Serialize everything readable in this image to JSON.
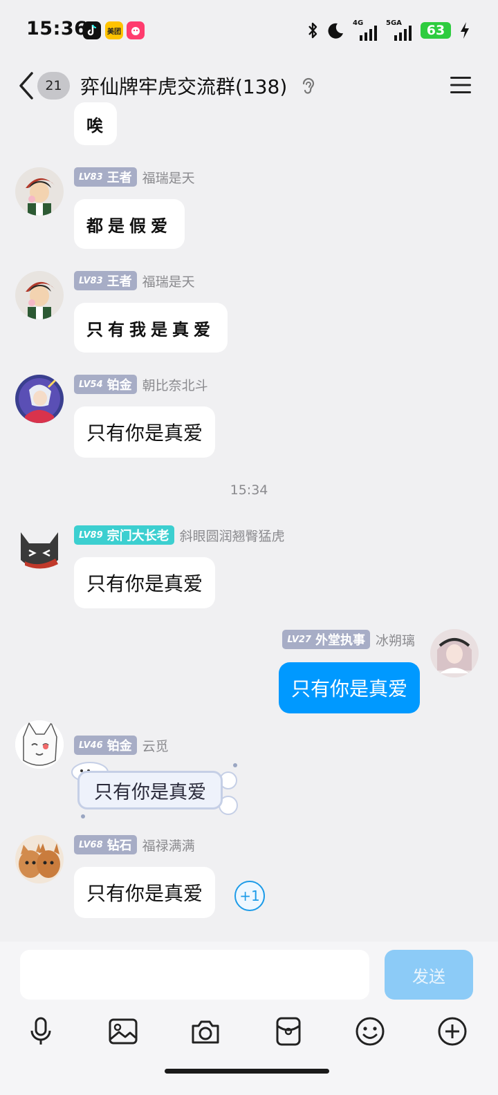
{
  "status_bar": {
    "time": "15:36",
    "apps": [
      {
        "name": "tiktok-icon",
        "color": "#111111"
      },
      {
        "name": "meituan-icon",
        "label": "美团",
        "color": "#ffc300"
      },
      {
        "name": "pinduoduo-icon",
        "color": "#ff3c6e"
      }
    ],
    "network_1": "4G",
    "network_2": "5GA",
    "battery": "63"
  },
  "header": {
    "unread_count": "21",
    "title": "弈仙牌牢虎交流群(138)"
  },
  "messages": [
    {
      "id": "m1",
      "level": "LV83",
      "title": "王者",
      "sender": "福瑞是天",
      "text": "都是假爱",
      "style": "handwritten"
    },
    {
      "id": "m2",
      "level": "LV83",
      "title": "王者",
      "sender": "福瑞是天",
      "text": "只有我是真爱",
      "style": "handwritten"
    },
    {
      "id": "m3",
      "level": "LV54",
      "title": "铂金",
      "sender": "朝比奈北斗",
      "text": "只有你是真爱"
    },
    {
      "id": "m4",
      "level": "LV89",
      "title": "宗门大长老",
      "sender": "斜眼圆润翘臀猛虎",
      "text": "只有你是真爱",
      "badge_color": "#3ccfd0"
    },
    {
      "id": "m5",
      "level": "LV27",
      "title": "外堂执事",
      "sender": "冰朔璃",
      "text": "只有你是真爱",
      "own": true
    },
    {
      "id": "m6",
      "level": "LV46",
      "title": "铂金",
      "sender": "云觅",
      "text": "只有你是真爱",
      "style": "decorated"
    },
    {
      "id": "m7",
      "level": "LV68",
      "title": "钻石",
      "sender": "福禄满满",
      "text": "只有你是真爱"
    }
  ],
  "time_divider": "15:34",
  "plus_one": "+1",
  "partial_bubble_text": "唉",
  "input": {
    "value": "",
    "send_label": "发送"
  },
  "toolbar": [
    "microphone-icon",
    "image-icon",
    "camera-icon",
    "red-packet-icon",
    "emoji-icon",
    "plus-icon"
  ],
  "colors": {
    "accent": "#0099ff",
    "send_disabled": "#8ccbf7",
    "badge_default": "#a7adc6",
    "badge_teal": "#3ccfd0",
    "background": "#f0f0f2"
  }
}
